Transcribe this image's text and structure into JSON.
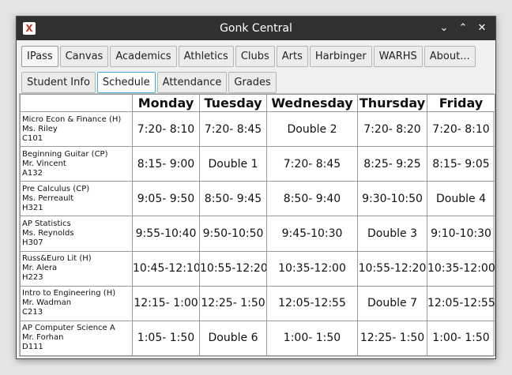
{
  "window": {
    "title": "Gonk Central",
    "icon": "app-logo-icon",
    "controls": {
      "minimize": "⌄",
      "maximize": "⌃",
      "close": "✕"
    }
  },
  "top_tabs": [
    {
      "label": "IPass",
      "selected": true
    },
    {
      "label": "Canvas"
    },
    {
      "label": "Academics"
    },
    {
      "label": "Athletics"
    },
    {
      "label": "Clubs"
    },
    {
      "label": "Arts"
    },
    {
      "label": "Harbinger"
    },
    {
      "label": "WARHS"
    },
    {
      "label": "About..."
    }
  ],
  "sub_tabs": [
    {
      "label": "Student Info"
    },
    {
      "label": "Schedule",
      "selected": true
    },
    {
      "label": "Attendance"
    },
    {
      "label": "Grades"
    }
  ],
  "schedule": {
    "days": [
      "Monday",
      "Tuesday",
      "Wednesday",
      "Thursday",
      "Friday"
    ],
    "rows": [
      {
        "course": "Micro Econ & Finance (H)",
        "teacher": "Ms. Riley",
        "room": "C101",
        "times": [
          "7:20- 8:10",
          "7:20- 8:45",
          "Double 2",
          "7:20- 8:20",
          "7:20- 8:10"
        ]
      },
      {
        "course": "Beginning Guitar (CP)",
        "teacher": "Mr. Vincent",
        "room": "A132",
        "times": [
          "8:15- 9:00",
          "Double 1",
          "7:20- 8:45",
          "8:25- 9:25",
          "8:15- 9:05"
        ]
      },
      {
        "course": "Pre Calculus (CP)",
        "teacher": "Ms. Perreault",
        "room": "H321",
        "times": [
          "9:05- 9:50",
          "8:50- 9:45",
          "8:50- 9:40",
          "9:30-10:50",
          "Double 4"
        ]
      },
      {
        "course": "AP Statistics",
        "teacher": "Ms. Reynolds",
        "room": "H307",
        "times": [
          "9:55-10:40",
          "9:50-10:50",
          "9:45-10:30",
          "Double 3",
          "9:10-10:30"
        ]
      },
      {
        "course": "Russ&Euro Lit (H)",
        "teacher": "Mr. Alera",
        "room": "H223",
        "times": [
          "10:45-12:10",
          "10:55-12:20",
          "10:35-12:00",
          "10:55-12:20",
          "10:35-12:00"
        ]
      },
      {
        "course": "Intro to Engineering (H)",
        "teacher": "Mr. Wadman",
        "room": "C213",
        "times": [
          "12:15- 1:00",
          "12:25- 1:50",
          "12:05-12:55",
          "Double 7",
          "12:05-12:55"
        ]
      },
      {
        "course": "AP Computer Science A",
        "teacher": "Mr. Forhan",
        "room": "D111",
        "times": [
          "1:05- 1:50",
          "Double 6",
          "1:00- 1:50",
          "12:25- 1:50",
          "1:00- 1:50"
        ]
      }
    ]
  }
}
